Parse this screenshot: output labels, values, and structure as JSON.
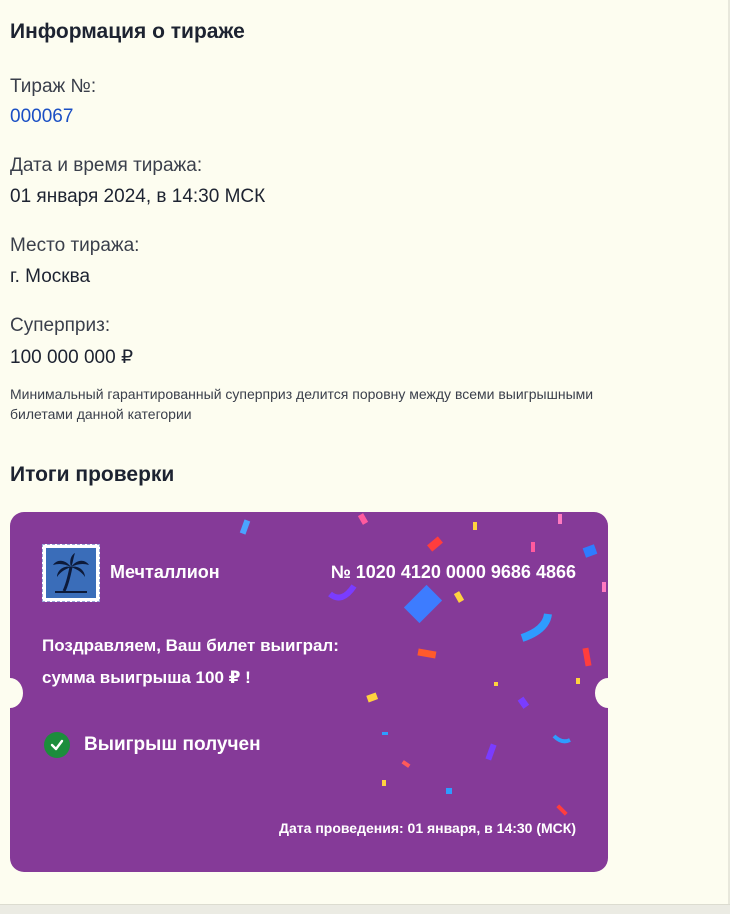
{
  "draw_info": {
    "title": "Информация о тираже",
    "draw_number_label": "Тираж №:",
    "draw_number_value": "000067",
    "datetime_label": "Дата и время тиража:",
    "datetime_value": "01 января 2024, в 14:30 МСК",
    "place_label": "Место тиража:",
    "place_value": "г. Москва",
    "superprize_label": "Суперприз:",
    "superprize_value": "100 000 000 ₽",
    "note": "Минимальный гарантированный суперприз делится поровну между всеми выигрышными билетами данной категории"
  },
  "check_results": {
    "title": "Итоги проверки",
    "ticket": {
      "brand": "Мечталлион",
      "number": "№ 1020 4120 0000 9686 4866",
      "congrats_line1": "Поздравляем, Ваш билет выиграл:",
      "congrats_line2": "сумма выигрыша 100 ₽ !",
      "status": "Выигрыш получен",
      "date": "Дата проведения: 01 января, в 14:30 (МСК)",
      "icons": {
        "logo": "palm-tree-icon",
        "status": "check-circle-icon"
      }
    }
  },
  "colors": {
    "background": "#fdfdf0",
    "ticket": "#853a98",
    "link": "#1a4fc4",
    "success": "#1c8d3c"
  }
}
